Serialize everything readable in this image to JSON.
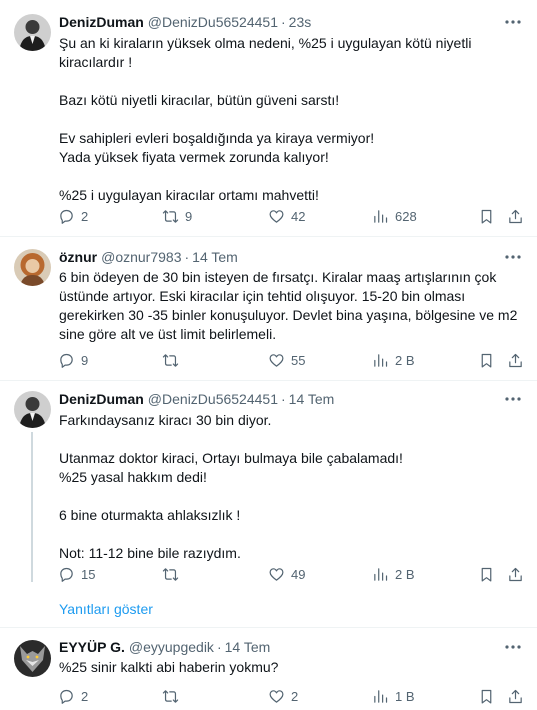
{
  "tweets": [
    {
      "name": "DenizDuman",
      "handle": "@DenizDu56524451",
      "time": "23s",
      "text": "Şu an ki kiraların yüksek olma nedeni, %25 i uygulayan kötü niyetli kiracılardır !\n\nBazı  kötü niyetli kiracılar, bütün güveni sarstı!\n\nEv sahipleri evleri boşaldığında ya kiraya vermiyor!\nYada yüksek fiyata vermek zorunda kalıyor!\n\n%25 i uygulayan kiracılar ortamı mahvetti!",
      "replies": "2",
      "retweets": "9",
      "likes": "42",
      "views": "628"
    },
    {
      "name": "öznur",
      "handle": "@oznur7983",
      "time": "14 Tem",
      "text": "6 bin ödeyen de 30 bin isteyen de fırsatçı. Kiralar maaş artışlarının çok üstünde artıyor. Eski kiracılar için tehtid olışuyor. 15-20 bin olması gerekirken 30 -35 binler konuşuluyor. Devlet bina yaşına, bölgesine ve m2 sine göre alt ve üst limit belirlemeli.",
      "replies": "9",
      "retweets": "",
      "likes": "55",
      "views": "2 B"
    },
    {
      "name": "DenizDuman",
      "handle": "@DenizDu56524451",
      "time": "14 Tem",
      "text": "Farkındaysanız kiracı 30 bin  diyor.\n\nUtanmaz doktor kiraci, Ortayı bulmaya bile çabalamadı!\n%25 yasal hakkım dedi!\n\n6 bine oturmakta ahlaksızlık !\n\nNot: 11-12 bine bile razıydım.",
      "replies": "15",
      "retweets": "",
      "likes": "49",
      "views": "2 B"
    },
    {
      "name": "EYYÜP G.",
      "handle": "@eyyupgedik",
      "time": "14 Tem",
      "text": "%25 sinir kalkti abi haberin yokmu?",
      "replies": "2",
      "retweets": "",
      "likes": "2",
      "views": "1 B"
    }
  ],
  "show_replies": "Yanıtları göster",
  "icons": {
    "more": "more-horizontal-icon",
    "reply": "reply-icon",
    "retweet": "retweet-icon",
    "like": "heart-icon",
    "views": "views-chart-icon",
    "bookmark": "bookmark-icon",
    "share": "share-icon"
  },
  "colors": {
    "text": "#0f1419",
    "secondary": "#536471",
    "link": "#1d9bf0",
    "divider": "#eff3f4",
    "thread_line": "#cfd9de"
  }
}
